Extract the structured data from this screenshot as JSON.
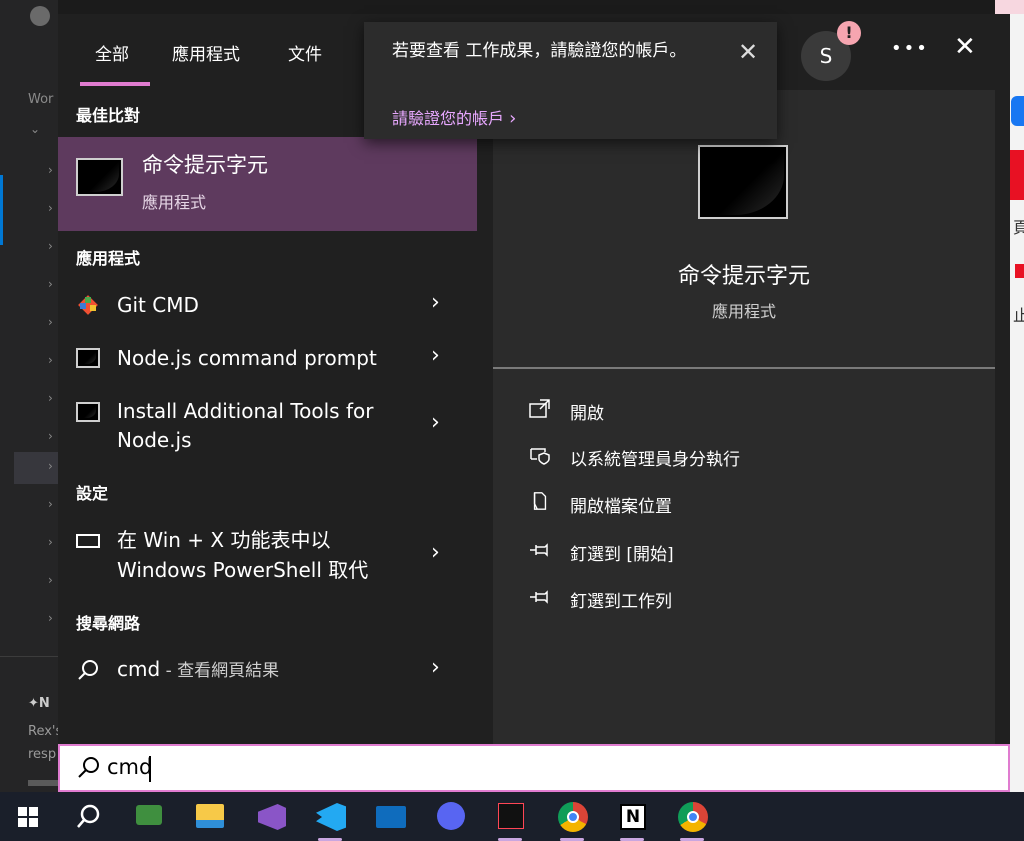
{
  "tabs": [
    {
      "label": "全部",
      "active": true
    },
    {
      "label": "應用程式",
      "active": false
    },
    {
      "label": "文件",
      "active": false
    }
  ],
  "popup": {
    "message": "若要查看 工作成果，請驗證您的帳戶。",
    "link": "請驗證您的帳戶"
  },
  "user": {
    "avatar_initial": "S",
    "alert_glyph": "!"
  },
  "header_icons": [
    "more-icon",
    "close-icon"
  ],
  "sections": {
    "best_match": "最佳比對",
    "apps": "應用程式",
    "settings": "設定",
    "web": "搜尋網路"
  },
  "best_match": {
    "title": "命令提示字元",
    "subtitle": "應用程式"
  },
  "apps": [
    {
      "title": "Git CMD",
      "icon": "git-icon"
    },
    {
      "title": "Node.js command prompt",
      "icon": "console-icon"
    },
    {
      "title_line1": "Install Additional Tools for",
      "title_line2": "Node.js",
      "icon": "console-icon"
    }
  ],
  "settings_item": {
    "line1": "在 Win + X 功能表中以",
    "line2": "Windows PowerShell 取代",
    "icon": "monitor-icon"
  },
  "web_item": {
    "query": "cmd",
    "suffix": " - 查看網頁結果",
    "icon": "search-icon"
  },
  "detail": {
    "title": "命令提示字元",
    "subtitle": "應用程式",
    "actions": [
      {
        "label": "開啟",
        "icon": "open-icon"
      },
      {
        "label": "以系統管理員身分執行",
        "icon": "shield-icon"
      },
      {
        "label": "開啟檔案位置",
        "icon": "file-location-icon"
      },
      {
        "label": "釘選到 [開始]",
        "icon": "pin-icon"
      },
      {
        "label": "釘選到工作列",
        "icon": "pin-icon"
      }
    ]
  },
  "search": {
    "value": "cmd"
  },
  "background": {
    "editor_left_label": "Wor",
    "bottom_text_1": "Rex's",
    "bottom_text_2": "resp",
    "bottom_label": "N",
    "right_fragment_1": "頁",
    "right_fragment_2": "止"
  },
  "taskbar": [
    "windows-start-icon",
    "search-icon",
    "gpu-app-icon",
    "file-explorer-icon",
    "visual-studio-icon",
    "vscode-icon",
    "mail-icon",
    "discord-icon",
    "valorant-icon",
    "chrome-icon",
    "notion-icon",
    "chrome-icon"
  ],
  "colors": {
    "accent": "#e07cd0",
    "selection": "#5e3a5e",
    "panel": "#202020",
    "detail_pane": "#2b2b2b"
  }
}
